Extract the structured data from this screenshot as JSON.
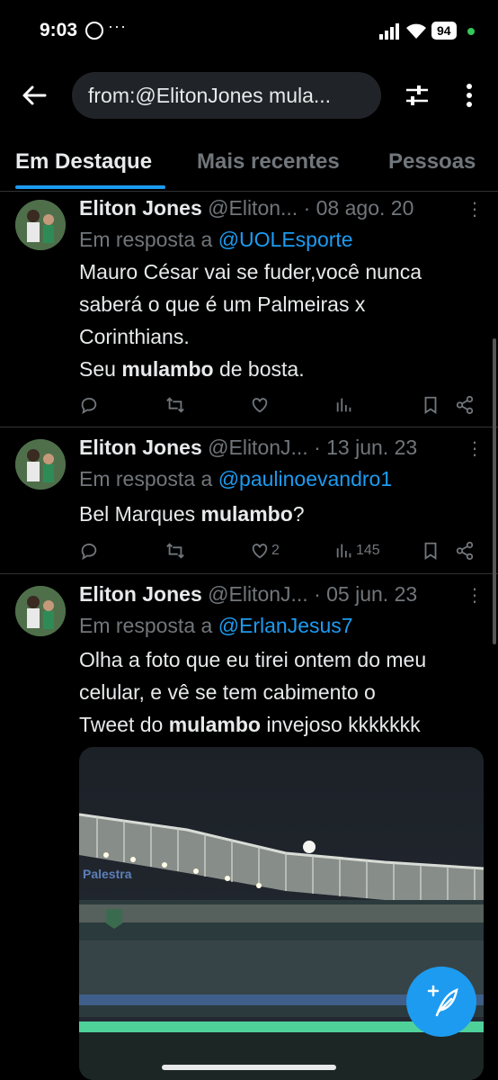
{
  "status_bar": {
    "time": "9:03",
    "dots": "···",
    "battery": "94"
  },
  "header": {
    "search_text": "from:@ElitonJones mula..."
  },
  "tabs": [
    {
      "label": "Em Destaque"
    },
    {
      "label": "Mais recentes"
    },
    {
      "label": "Pessoas"
    }
  ],
  "tweets": [
    {
      "name": "Eliton Jones",
      "handle": "@Eliton...",
      "date": "· 08 ago. 20",
      "reply_prefix": "Em resposta a",
      "reply_to": "@UOLEsporte",
      "text_line1": "Mauro César vai se fuder,você nunca",
      "text_line2": "saberá o que é um Palmeiras x",
      "text_line3": "Corinthians.",
      "text_line4_pre": "Seu ",
      "text_line4_bold": "mulambo",
      "text_line4_post": " de bosta."
    },
    {
      "name": "Eliton Jones",
      "handle": "@ElitonJ...",
      "date": "· 13 jun. 23",
      "reply_prefix": "Em resposta a",
      "reply_to": "@paulinoevandro1",
      "text_pre": "Bel Marques ",
      "text_bold": "mulambo",
      "text_post": "?",
      "likes": "2",
      "views": "145"
    },
    {
      "name": "Eliton Jones",
      "handle": "@ElitonJ...",
      "date": "· 05 jun. 23",
      "reply_prefix": "Em resposta a",
      "reply_to": "@ErlanJesus7",
      "text_line1": "Olha a foto que eu tirei ontem do meu",
      "text_line2": "celular, e vê se tem cabimento o",
      "text_line3_pre": "Tweet do ",
      "text_line3_bold": "mulambo",
      "text_line3_post": " invejoso kkkkkkk",
      "photo_sign": "Palestra"
    }
  ],
  "colors": {
    "accent": "#1d9bf0",
    "muted": "#71767b",
    "text": "#e7e9ea",
    "bg": "#000000"
  }
}
